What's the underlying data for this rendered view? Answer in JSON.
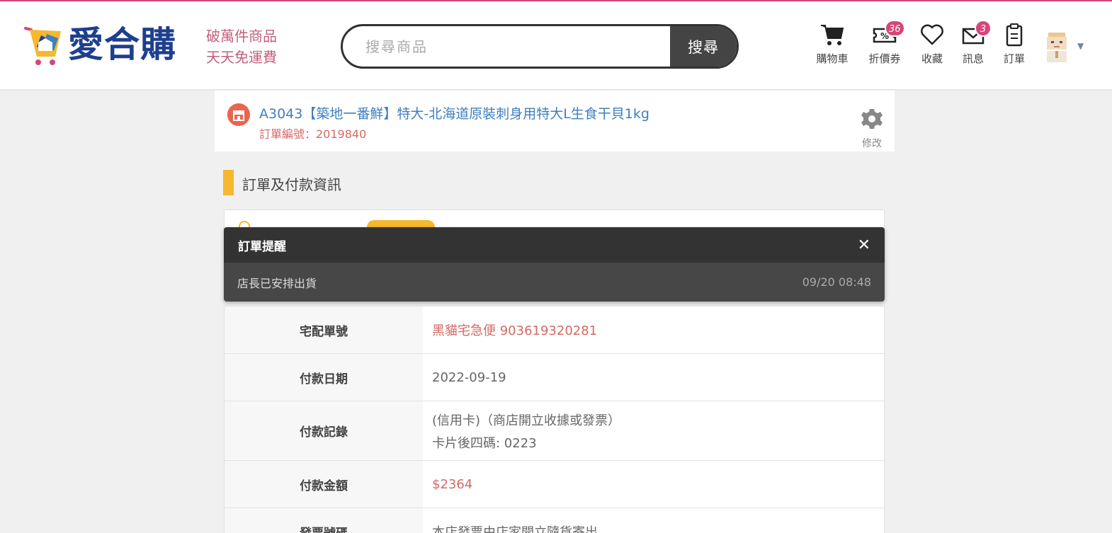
{
  "header": {
    "logo_text": "愛合購",
    "slogan_line1": "破萬件商品",
    "slogan_line2": "天天免運費",
    "search_placeholder": "搜尋商品",
    "search_button": "搜尋",
    "nav": {
      "cart": "購物車",
      "coupons": "折價券",
      "coupons_badge": "36",
      "favorites": "收藏",
      "messages": "訊息",
      "messages_badge": "3",
      "orders": "訂單"
    }
  },
  "product": {
    "title": "A3043【築地一番鮮】特大-北海道原裝刺身用特大L生食干貝1kg",
    "order_number": "訂單編號：2019840",
    "edit_label": "修改"
  },
  "section": {
    "title": "訂單及付款資訊"
  },
  "notification": {
    "title": "訂單提醒",
    "message": "店長已安排出貨",
    "time": "09/20 08:48"
  },
  "info_rows": {
    "tracking_label": "宅配單號",
    "tracking_value": "黑貓宅急便 903619320281",
    "pay_date_label": "付款日期",
    "pay_date_value": "2022-09-19",
    "pay_record_label": "付款記錄",
    "pay_record_line1": "(信用卡)（商店開立收據或發票）",
    "pay_record_line2": "卡片後四碼: 0223",
    "amount_label": "付款金額",
    "amount_value": "$2364",
    "invoice_label": "發票號碼",
    "invoice_value": "本店發票由店家開立隨貨寄出"
  },
  "colors": {
    "accent_pink": "#d5467a",
    "logo_blue": "#1e3f8f",
    "section_yellow": "#f5b82e",
    "link_blue": "#3f7fbf",
    "price_red": "#d36a65"
  }
}
